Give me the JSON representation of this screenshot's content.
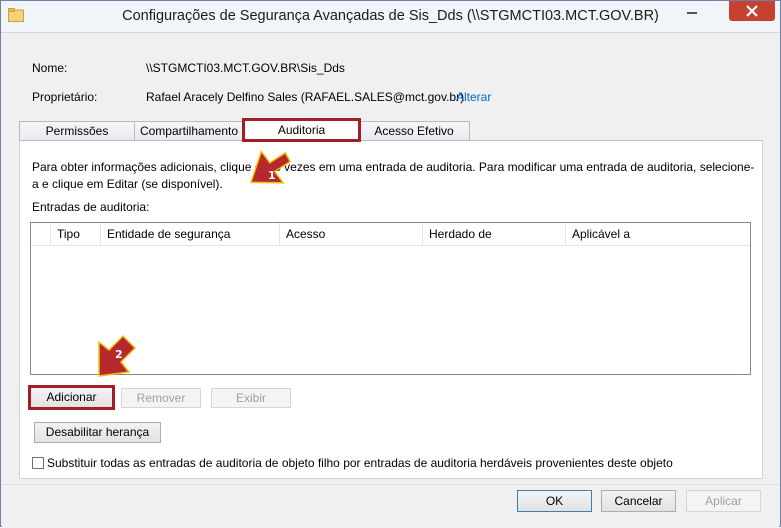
{
  "window": {
    "title": "Configurações de Segurança Avançadas de Sis_Dds (\\\\STGMCTI03.MCT.GOV.BR)"
  },
  "info": {
    "name_label": "Nome:",
    "name_value": "\\\\STGMCTI03.MCT.GOV.BR\\Sis_Dds",
    "owner_label": "Proprietário:",
    "owner_value": "Rafael Aracely Delfino Sales (RAFAEL.SALES@mct.gov.br)",
    "owner_change_link": "Alterar"
  },
  "tabs": [
    {
      "label": "Permissões"
    },
    {
      "label": "Compartilhamento"
    },
    {
      "label": "Auditoria"
    },
    {
      "label": "Acesso Efetivo"
    }
  ],
  "audit": {
    "description": "Para obter informações adicionais, clique duas vezes em uma entrada de auditoria. Para modificar uma entrada de auditoria, selecione-a e clique em Editar (se disponível).",
    "entries_label": "Entradas de auditoria:",
    "columns": [
      "Tipo",
      "Entidade de segurança",
      "Acesso",
      "Herdado de",
      "Aplicável a"
    ],
    "add_button": "Adicionar",
    "remove_button": "Remover",
    "view_button": "Exibir",
    "disable_inheritance_button": "Desabilitar herança",
    "replace_checkbox_label": "Substituir todas as entradas de auditoria de objeto filho por entradas de auditoria herdáveis provenientes deste objeto"
  },
  "footer": {
    "ok": "OK",
    "cancel": "Cancelar",
    "apply": "Aplicar"
  },
  "callouts": [
    "1",
    "2"
  ],
  "colors": {
    "highlight": "#a51c24",
    "callout": "#c0392b",
    "close_button": "#c7412f",
    "link": "#0066cc"
  }
}
